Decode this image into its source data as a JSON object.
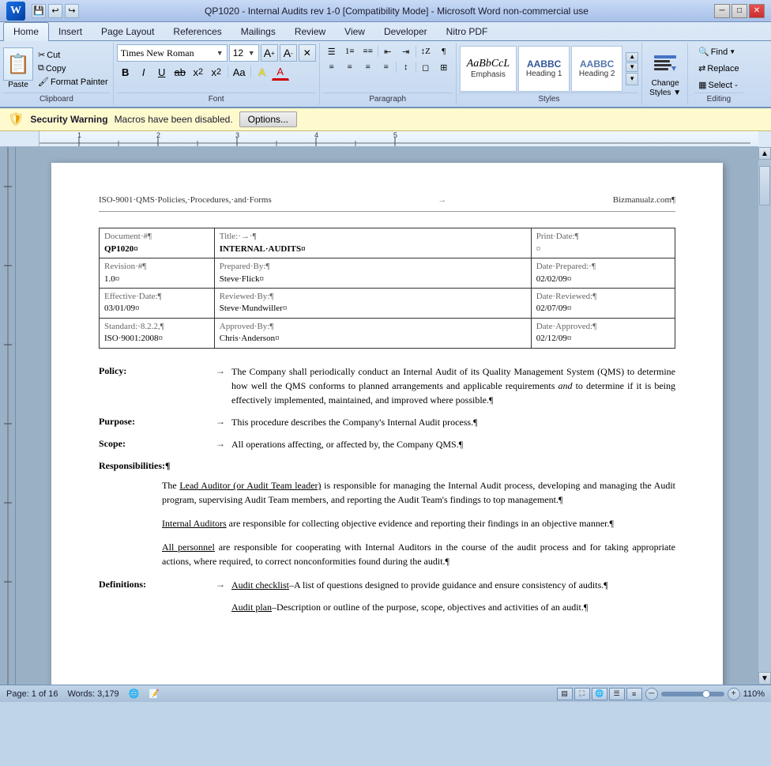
{
  "window": {
    "title": "QP1020 - Internal Audits rev 1-0 [Compatibility Mode] - Microsoft Word non-commercial use",
    "min_btn": "─",
    "max_btn": "□",
    "close_btn": "✕"
  },
  "tabs": {
    "items": [
      "Home",
      "Insert",
      "Page Layout",
      "References",
      "Mailings",
      "Review",
      "View",
      "Developer",
      "Nitro PDF"
    ],
    "active": "Home"
  },
  "clipboard": {
    "group_label": "Clipboard",
    "paste_label": "Paste",
    "cut_label": "Cut",
    "copy_label": "Copy",
    "format_painter_label": "Format Painter"
  },
  "font": {
    "group_label": "Font",
    "name": "Times New Roman",
    "size": "12",
    "bold": "B",
    "italic": "I",
    "underline": "U",
    "strikethrough": "ab",
    "subscript": "x₂",
    "superscript": "x²",
    "change_case": "Aa",
    "highlight": "A",
    "font_color": "A",
    "grow": "A",
    "shrink": "A",
    "clear": "A"
  },
  "paragraph": {
    "group_label": "Paragraph",
    "bullets": "≡",
    "numbering": "≡",
    "multilevel": "≡",
    "decrease_indent": "⇤",
    "increase_indent": "⇥",
    "sort": "↕",
    "show_marks": "¶",
    "align_left": "≡",
    "center": "≡",
    "align_right": "≡",
    "justify": "≡",
    "line_spacing": "≡",
    "shading": "◻",
    "borders": "◻"
  },
  "styles": {
    "group_label": "Styles",
    "items": [
      {
        "name": "emphasis-style",
        "label": "AaBbCcL",
        "style": "italic",
        "caption": "Emphasis"
      },
      {
        "name": "heading1-style",
        "label": "AABBC",
        "style": "bold",
        "caption": "Heading 1"
      },
      {
        "name": "heading2-style",
        "label": "AABBC",
        "style": "bold",
        "caption": "Heading 2"
      },
      {
        "name": "more-style",
        "label": "...",
        "style": "",
        "caption": ""
      }
    ],
    "change_styles_label": "Change\nStyles",
    "change_styles_icon": "▼"
  },
  "editing": {
    "group_label": "Editing",
    "find_label": "Find",
    "find_arrow": "▼",
    "replace_label": "Replace",
    "select_label": "Select -"
  },
  "security": {
    "warning_label": "Security Warning",
    "warning_text": "Macros have been disabled.",
    "options_btn": "Options..."
  },
  "status_bar": {
    "page_info": "Page: 1 of 16",
    "words": "Words: 3,179",
    "zoom": "110%",
    "zoom_minus": "─",
    "zoom_plus": "+"
  },
  "document": {
    "header_left": "ISO-9001·QMS·Policies,·Procedures,·and·Forms",
    "header_right": "Bizmanualz.com¶",
    "table": {
      "rows": [
        [
          {
            "text": "Document·#¶\nQP1020¤",
            "bold_line2": true
          },
          {
            "text": "Title:·→·¶\nINTERNAL·AUDITS¤",
            "bold_line2": true
          },
          {
            "text": "Print·Date:¶\n¤",
            "col": 3
          }
        ],
        [
          {
            "text": "Revision·#¶\n1.0¤"
          },
          {
            "text": "Prepared·By:¶\nSteve·Flick¤"
          },
          {
            "text": "Date·Prepared:·¶\n02/02/09¤"
          }
        ],
        [
          {
            "text": "Effective·Date:¶\n03/01/09¤"
          },
          {
            "text": "Reviewed·By:¶\nSteve·Mundwiller¤"
          },
          {
            "text": "Date·Reviewed:¶\n02/07/09¤"
          }
        ],
        [
          {
            "text": "Standard:·8.2.2,¶\nISO·9001:2008¤"
          },
          {
            "text": "Approved·By:¶\nChris·Anderson¤"
          },
          {
            "text": "Date·Approved:¶\n02/12/09¤"
          }
        ]
      ]
    },
    "policy_label": "Policy:",
    "policy_text": "The Company shall periodically conduct an Internal Audit of its Quality Management System (QMS) to determine how well the QMS conforms to planned arrangements and applicable requirements and to determine if it is being effectively implemented, maintained, and improved where possible.¶",
    "policy_italic_word": "and",
    "purpose_label": "Purpose:",
    "purpose_text": "This procedure describes the Company's Internal Audit process.¶",
    "scope_label": "Scope:",
    "scope_text": "All operations affecting, or affected by, the Company QMS.¶",
    "responsibilities_label": "Responsibilities:¶",
    "resp_para1": "The Lead Auditor (or Audit Team leader) is responsible for managing the Internal Audit process, developing and managing the Audit program, supervising Audit Team members, and reporting the Audit Team's findings to top management.¶",
    "resp_para1_underline": "Lead Auditor (or Audit Team leader)",
    "resp_para2": "Internal Auditors are responsible for collecting objective evidence and reporting their findings in an objective manner.¶",
    "resp_para2_underline": "Internal Auditors",
    "resp_para3": "All personnel are responsible for cooperating with Internal Auditors in the course of the audit process and for taking appropriate actions, where required, to correct nonconformities found during the audit.¶",
    "resp_para3_underline": "All personnel",
    "definitions_label": "Definitions:",
    "def_para1_label": "Audit checklist",
    "def_para1_text": "–A list of questions designed to provide guidance and ensure consistency of audits.¶",
    "def_para2_label": "Audit plan",
    "def_para2_text": "–Description or outline of the purpose, scope, objectives and activities of an audit.¶"
  },
  "icons": {
    "paste": "📋",
    "cut": "✂",
    "copy": "⧉",
    "format_painter": "🖌",
    "find": "🔍",
    "bold": "B",
    "italic": "I",
    "underline": "U",
    "shield": "🛡",
    "word_logo": "W"
  }
}
